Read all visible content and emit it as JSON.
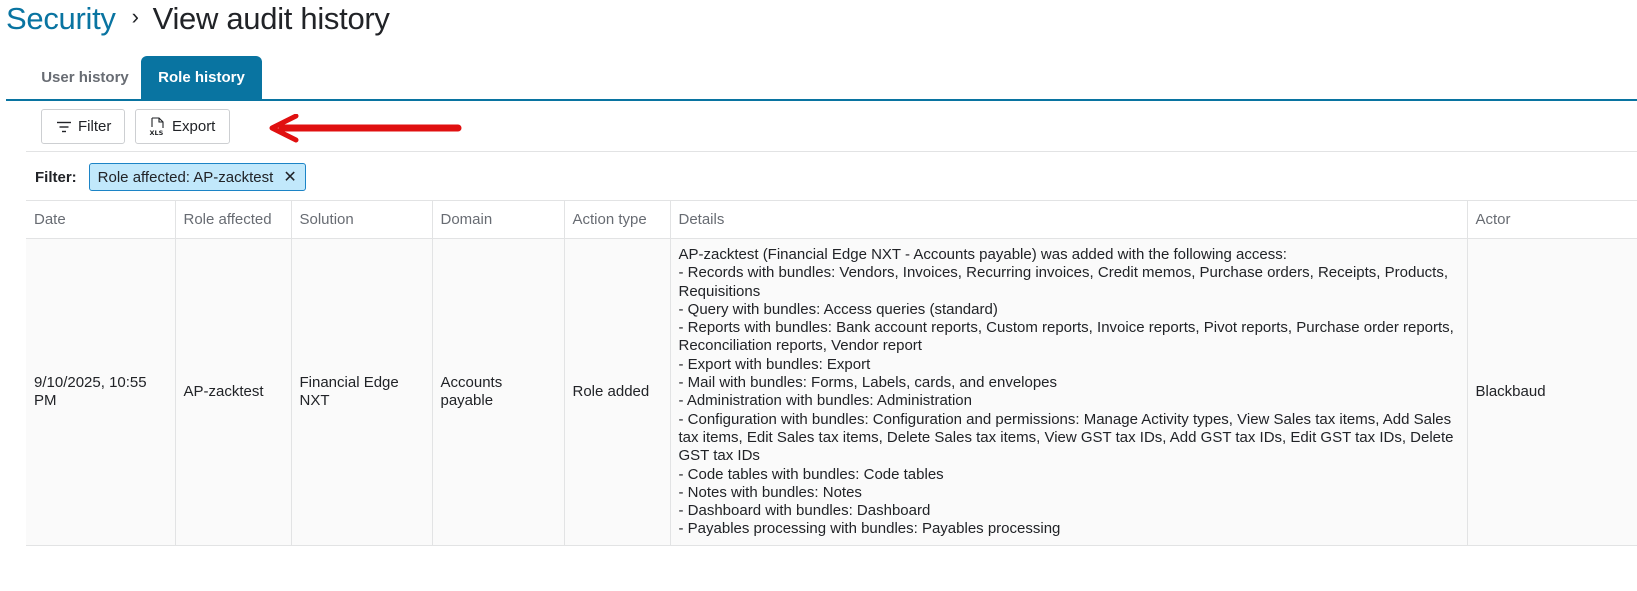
{
  "header": {
    "breadcrumb_parent": "Security",
    "separator": "›",
    "title": "View audit history"
  },
  "tabs": [
    {
      "label": "User history",
      "active": false
    },
    {
      "label": "Role history",
      "active": true
    }
  ],
  "toolbar": {
    "filter_label": "Filter",
    "export_label": "Export",
    "filter_icon": "filter-lines-icon",
    "export_icon": "xls-file-icon"
  },
  "filter_bar": {
    "label": "Filter:",
    "chips": [
      {
        "text": "Role affected: AP-zacktest",
        "close": "✕"
      }
    ]
  },
  "table": {
    "columns": [
      "Date",
      "Role affected",
      "Solution",
      "Domain",
      "Action type",
      "Details",
      "Actor"
    ],
    "rows": [
      {
        "date": "9/10/2025, 10:55 PM",
        "role": "AP-zacktest",
        "solution": "Financial Edge NXT",
        "domain": "Accounts payable",
        "action": "Role added",
        "details": [
          "AP-zacktest (Financial Edge NXT - Accounts payable) was added with the following access:",
          "- Records with bundles: Vendors, Invoices, Recurring invoices, Credit memos, Purchase orders, Receipts, Products, Requisitions",
          "- Query with bundles: Access queries (standard)",
          "- Reports with bundles: Bank account reports, Custom reports, Invoice reports, Pivot reports, Purchase order reports, Reconciliation reports, Vendor report",
          "- Export with bundles: Export",
          "- Mail with bundles: Forms, Labels, cards, and envelopes",
          "- Administration with bundles: Administration",
          "- Configuration with bundles: Configuration and permissions: Manage Activity types, View Sales tax items, Add Sales tax items, Edit Sales tax items, Delete Sales tax items, View GST tax IDs, Add GST tax IDs, Edit GST tax IDs, Delete GST tax IDs",
          "- Code tables with bundles: Code tables",
          "- Notes with bundles: Notes",
          "- Dashboard with bundles: Dashboard",
          "- Payables processing with bundles: Payables processing"
        ],
        "actor": "Blackbaud"
      }
    ]
  },
  "colors": {
    "primary": "#0974a1",
    "chip_bg": "#c1e8fb",
    "chip_border": "#1c84c6",
    "annotation_arrow": "#e01010",
    "row_bg": "#fafafa",
    "header_text": "#686c73"
  }
}
